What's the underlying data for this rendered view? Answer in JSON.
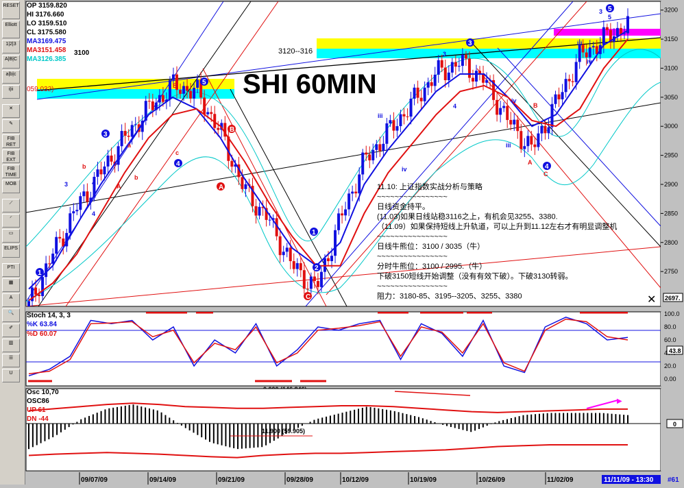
{
  "toolbar": {
    "tools": [
      {
        "name": "reset-button",
        "label": "RESET"
      },
      {
        "name": "elliott-button",
        "label": "Elliott"
      },
      {
        "name": "wave-numbers-button",
        "label": "1|2|3"
      },
      {
        "name": "wave-abc-button",
        "label": "A|B|C"
      },
      {
        "name": "wave-abc-small-button",
        "label": "a|b|c"
      },
      {
        "name": "wave-i-button",
        "label": "i|ii"
      },
      {
        "name": "cross-tool-button",
        "label": "✕"
      },
      {
        "name": "pencil-tool-button",
        "label": "✎"
      },
      {
        "name": "fib-ret-button",
        "label": "FIB RET"
      },
      {
        "name": "fib-ext-button",
        "label": "FIB EXT"
      },
      {
        "name": "fib-time-button",
        "label": "FIB TIME"
      },
      {
        "name": "mob-button",
        "label": "MOB"
      },
      {
        "name": "fan-button",
        "label": "⟋"
      },
      {
        "name": "arc-button",
        "label": "◜"
      },
      {
        "name": "rect-button",
        "label": "▭"
      },
      {
        "name": "ellipse-button",
        "label": "ELIPS"
      },
      {
        "name": "pti-button",
        "label": "PTI"
      },
      {
        "name": "grid-button",
        "label": "▦"
      },
      {
        "name": "text-button",
        "label": "A"
      },
      {
        "name": "zoom-button",
        "label": "🔍"
      },
      {
        "name": "paint-button",
        "label": "✐"
      },
      {
        "name": "bars-button",
        "label": "▥"
      },
      {
        "name": "list-button",
        "label": "☰"
      },
      {
        "name": "magnet-button",
        "label": "U"
      }
    ]
  },
  "price_panel": {
    "ohlc": {
      "op": "OP 3159.820",
      "hi": "HI  3176.660",
      "lo": "LO  3159.510",
      "cl": "CL  3175.580"
    },
    "ma": [
      {
        "label": "MA3169.475",
        "color": "#1010e0"
      },
      {
        "label": "MA3151.458",
        "color": "#e01010"
      },
      {
        "label": "MA3126.385",
        "color": "#00c8c8"
      }
    ],
    "ma_extra": "3100",
    "title": "SHI 60MIN",
    "box_left_label": "059.032)",
    "box_mid_label": "3120--316",
    "y_axis": [
      "3200",
      "3150",
      "3100",
      "3050",
      "3000",
      "2950",
      "2900",
      "2850",
      "2800",
      "2750"
    ],
    "price_tag": "2697.",
    "commentary": [
      "11.10: 上证指数实战分析与策略",
      "~~~~~~~~~~~~~~~~",
      "日线资金持平。",
      "(11.03)如果日线站稳3116之上，有机会见3255、3380.",
      "（11.09）如果保持短线上升轨道，可以上升到11.12左右才有明显调整机",
      "~~~~~~~~~~~~~~~~",
      "日线牛熊位：3100 / 3035（牛）",
      "~~~~~~~~~~~~~~~~",
      "分时牛熊位：3100 / 2995.（牛）",
      "下破3150短线开始调整（没有有效下破）。下破3130转弱。",
      "~~~~~~~~~~~~~~~~",
      "阻力：3180-85、3195--3205、3255、3380"
    ]
  },
  "stoch_panel": {
    "title": "Stoch 14, 3, 3",
    "k_label": "%K  63.84",
    "d_label": "%D  60.07",
    "y_axis": [
      "100.0",
      "80.0",
      "60.0",
      "40.0",
      "20.0",
      "0.00"
    ],
    "value_tag": "43.8",
    "annotation": "0.000 (146.846)"
  },
  "osc_panel": {
    "title": "Osc 10,70",
    "lines": [
      {
        "label": "OSC86",
        "color": "#000000"
      },
      {
        "label": "UP   61",
        "color": "#e01010"
      },
      {
        "label": "DN   -44",
        "color": "#e01010"
      }
    ],
    "zero_tag": "0",
    "annotation": "11.900 (59.905)"
  },
  "date_axis": {
    "labels": [
      "09/07/09",
      "09/14/09",
      "09/21/09",
      "09/28/09",
      "10/12/09",
      "10/19/09",
      "10/26/09",
      "11/02/09"
    ],
    "current": "11/11/09 - 13:30",
    "bar_tag": "#61"
  },
  "chart_data": [
    {
      "type": "candlestick",
      "title": "SHI 60MIN",
      "ylim": [
        2690,
        3215
      ],
      "x_ticks": [
        "09/07/09",
        "09/14/09",
        "09/21/09",
        "09/28/09",
        "10/12/09",
        "10/19/09",
        "10/26/09",
        "11/02/09",
        "11/11/09 - 13:30"
      ],
      "approx_closes": [
        2690,
        2780,
        2860,
        2920,
        2980,
        3030,
        3070,
        3060,
        2990,
        2890,
        2840,
        2760,
        2720,
        2840,
        2940,
        2990,
        3040,
        3090,
        3110,
        3080,
        3010,
        2960,
        3040,
        3120,
        3150,
        3175
      ],
      "ma_series": [
        {
          "name": "MA3169.475",
          "values": [
            2720,
            2760,
            2830,
            2900,
            2960,
            3020,
            3050,
            3030,
            2980,
            2910,
            2850,
            2790,
            2760,
            2800,
            2900,
            2960,
            3010,
            3060,
            3090,
            3090,
            3050,
            3000,
            3020,
            3080,
            3140,
            3165
          ]
        },
        {
          "name": "MA3151.458",
          "values": [
            2700,
            2730,
            2780,
            2850,
            2920,
            2980,
            3020,
            3030,
            3000,
            2940,
            2870,
            2810,
            2760,
            2760,
            2850,
            2920,
            2970,
            3020,
            3060,
            3070,
            3050,
            3010,
            3000,
            3030,
            3100,
            3150
          ]
        }
      ],
      "zones": [
        {
          "label": "059.032)",
          "ylow": 3059,
          "yhigh": 3086,
          "color": "#00ffff/#ffff00"
        },
        {
          "label": "3120--316",
          "ylow": 3120,
          "yhigh": 3166,
          "color": "#00ffff/#ffff00"
        },
        {
          "label": "",
          "ylow": 3158,
          "yhigh": 3175,
          "color": "#ff00ff"
        }
      ],
      "wave_labels": [
        "1",
        "2",
        "3",
        "4",
        "5",
        "A",
        "B",
        "C",
        "a",
        "b",
        "c",
        "i",
        "ii",
        "iii",
        "iv",
        "v"
      ]
    },
    {
      "type": "line",
      "title": "Stoch 14, 3, 3",
      "ylim": [
        0,
        100
      ],
      "series": [
        {
          "name": "%K  63.84",
          "values": [
            5,
            15,
            35,
            90,
            85,
            90,
            60,
            80,
            20,
            60,
            40,
            85,
            20,
            45,
            80,
            75,
            85,
            90,
            30,
            85,
            70,
            35,
            90,
            20,
            10,
            80,
            95,
            85,
            60,
            64
          ]
        },
        {
          "name": "%D  60.07",
          "values": [
            8,
            12,
            30,
            85,
            86,
            88,
            65,
            75,
            25,
            55,
            45,
            80,
            25,
            40,
            75,
            78,
            82,
            88,
            35,
            80,
            72,
            40,
            85,
            25,
            12,
            75,
            92,
            88,
            65,
            60
          ]
        }
      ],
      "reference_lines": [
        80,
        20
      ]
    },
    {
      "type": "bar",
      "title": "Osc 10,70",
      "series": [
        {
          "name": "OSC86",
          "values": [
            -60,
            -30,
            10,
            35,
            45,
            30,
            -10,
            -45,
            -60,
            -55,
            -20,
            10,
            25,
            40,
            30,
            15,
            -5,
            -20,
            5,
            20,
            25,
            25,
            25,
            20
          ]
        },
        {
          "name": "UP   61",
          "values": [
            30,
            35,
            40,
            45,
            48,
            45,
            40,
            38,
            36,
            36,
            38,
            40,
            42,
            42,
            40,
            36,
            32,
            28,
            26,
            28,
            30,
            32,
            34,
            34
          ]
        },
        {
          "name": "DN   -44",
          "values": [
            -75,
            -72,
            -70,
            -68,
            -70,
            -72,
            -75,
            -78,
            -80,
            -75,
            -72,
            -70,
            -70,
            -68,
            -66,
            -64,
            -62,
            -58,
            -54,
            -52,
            -50,
            -50,
            -50,
            -50
          ]
        }
      ]
    }
  ]
}
